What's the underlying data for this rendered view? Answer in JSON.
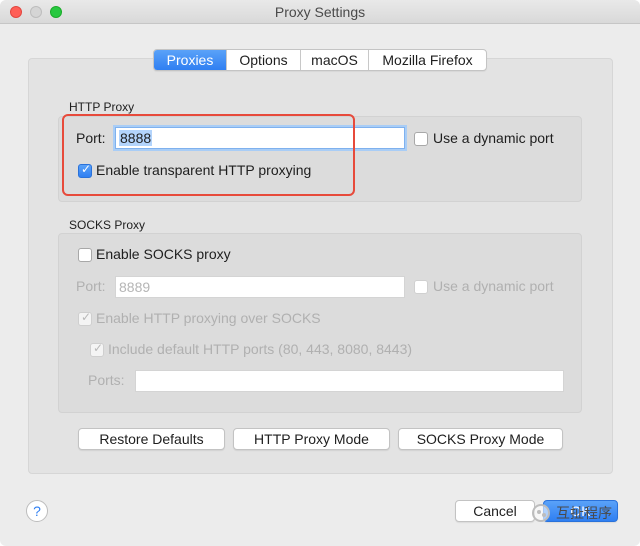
{
  "window": {
    "title": "Proxy Settings"
  },
  "tabs": [
    {
      "label": "Proxies",
      "active": true
    },
    {
      "label": "Options",
      "active": false
    },
    {
      "label": "macOS",
      "active": false
    },
    {
      "label": "Mozilla Firefox",
      "active": false
    }
  ],
  "http_proxy": {
    "section_label": "HTTP Proxy",
    "port_label": "Port:",
    "port_value": "8888",
    "dynamic_port_label": "Use a dynamic port",
    "dynamic_port_checked": false,
    "transparent_label": "Enable transparent HTTP proxying",
    "transparent_checked": true
  },
  "socks_proxy": {
    "section_label": "SOCKS Proxy",
    "enable_label": "Enable SOCKS proxy",
    "enable_checked": false,
    "port_label": "Port:",
    "port_placeholder": "8889",
    "dynamic_port_label": "Use a dynamic port",
    "http_over_socks_label": "Enable HTTP proxying over SOCKS",
    "include_ports_label": "Include default HTTP ports (80, 443, 8080, 8443)",
    "ports_label": "Ports:",
    "ports_value": ""
  },
  "buttons": {
    "restore_defaults": "Restore Defaults",
    "http_proxy_mode": "HTTP Proxy Mode",
    "socks_proxy_mode": "SOCKS Proxy Mode",
    "cancel": "Cancel",
    "ok": "OK",
    "help": "?"
  },
  "watermark": {
    "text": "互扯程序"
  },
  "colors": {
    "accent": "#2f7ff2",
    "highlight": "#e74a3b"
  }
}
